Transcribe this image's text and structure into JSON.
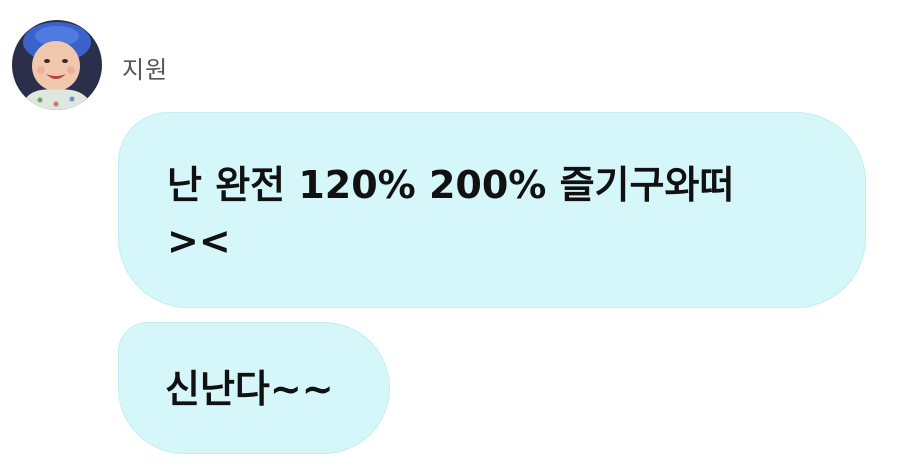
{
  "conversation": {
    "sender": {
      "name": "지원",
      "avatar_icon": "baby-photo-avatar"
    },
    "messages": [
      {
        "lines": [
          "난 완전 120% 200% 즐기구와떠",
          "><"
        ]
      },
      {
        "lines": [
          "신난다~~"
        ]
      }
    ]
  },
  "colors": {
    "bubble_bg": "#d6f7fa",
    "bubble_border": "#c2eef3",
    "text": "#111111",
    "sender_name": "#555555"
  }
}
